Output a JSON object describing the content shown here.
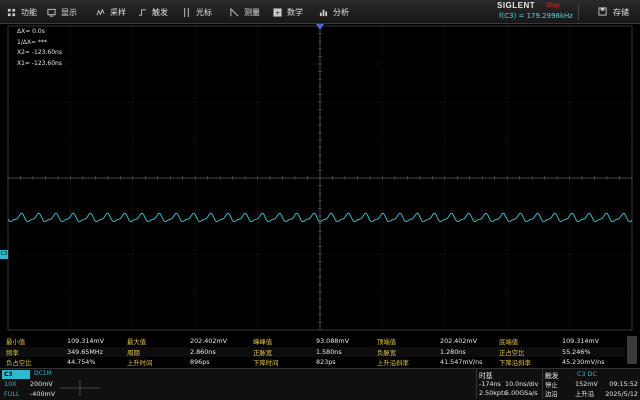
{
  "menu": {
    "items": [
      {
        "label": "功能",
        "icon": "function-icon"
      },
      {
        "label": "显示",
        "icon": "display-icon"
      },
      {
        "label": "采样",
        "icon": "acquire-icon"
      },
      {
        "label": "触发",
        "icon": "trigger-icon"
      },
      {
        "label": "光标",
        "icon": "cursor-icon"
      },
      {
        "label": "测量",
        "icon": "measure-icon"
      },
      {
        "label": "数学",
        "icon": "math-icon"
      },
      {
        "label": "分析",
        "icon": "analysis-icon"
      }
    ],
    "brand": "SIGLENT",
    "run_status": "Stop",
    "freq_readout": "f(C3) = 179.2998kHz",
    "save_label": "存储"
  },
  "cursor_info": {
    "dx": "ΔX= 0.0s",
    "inv_dx": "1/ΔX= ***",
    "x2": "X2= -123.60ns",
    "x1": "X1= -123.60ns"
  },
  "channel_marker": "C3",
  "colors": {
    "trace": "#2fb9cf",
    "label_yellow": "#e0c040",
    "stop_red": "#e03030",
    "grid": "#3a3a3a"
  },
  "measurements": [
    [
      {
        "label": "最小值",
        "value": "109.314mV"
      },
      {
        "label": "最大值",
        "value": "202.402mV"
      },
      {
        "label": "峰峰值",
        "value": "93.088mV"
      },
      {
        "label": "顶端值",
        "value": "202.402mV"
      },
      {
        "label": "底端值",
        "value": "109.314mV"
      }
    ],
    [
      {
        "label": "频率",
        "value": "349.65MHz"
      },
      {
        "label": "周期",
        "value": "2.860ns"
      },
      {
        "label": "正脉宽",
        "value": "1.580ns"
      },
      {
        "label": "负脉宽",
        "value": "1.280ns"
      },
      {
        "label": "正占空比",
        "value": "55.246%"
      }
    ],
    [
      {
        "label": "负占空比",
        "value": "44.754%"
      },
      {
        "label": "上升时间",
        "value": "896ps"
      },
      {
        "label": "下降时间",
        "value": "823ps"
      },
      {
        "label": "上升沿斜率",
        "value": "41.547mV/ns"
      },
      {
        "label": "下降沿斜率",
        "value": "45.230mV/ns"
      }
    ]
  ],
  "channel": {
    "name": "C3",
    "coupling": "DC1M",
    "probe": "10X",
    "scale": "200mV",
    "bandwidth": "FULL",
    "offset": "-400mV"
  },
  "timebase": {
    "title": "时基",
    "delay": "-174ns",
    "scale": "10.0ns/div",
    "memory": "2.50kpts",
    "sample_rate": "5.00GSa/s"
  },
  "trigger": {
    "title": "触发",
    "source": "C3 DC",
    "mode": "停止",
    "level": "152mV",
    "type": "边沿",
    "slope": "上升沿"
  },
  "clock": {
    "time": "09:15:52",
    "date": "2025/5/12"
  }
}
